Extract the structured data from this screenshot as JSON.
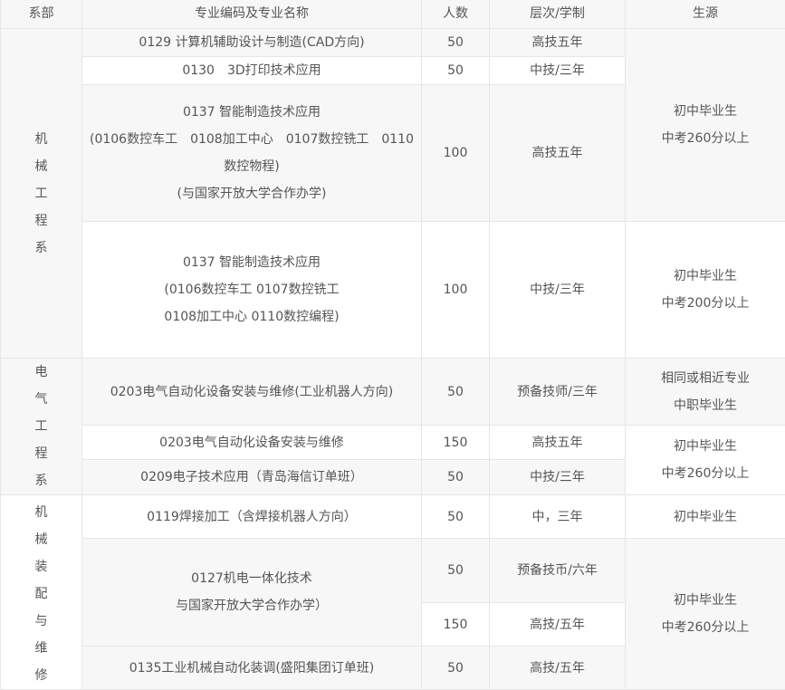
{
  "header": {
    "dept": "系部",
    "major": "专业编码及专业名称",
    "count": "人数",
    "level": "层次/学制",
    "source": "生源"
  },
  "departments": {
    "mech": [
      "机",
      "械",
      "工",
      "程",
      "系"
    ],
    "elec": [
      "电",
      "气",
      "工",
      "程",
      "系"
    ],
    "assembly": [
      "机",
      "械",
      "装",
      "配",
      "与",
      "维",
      "修"
    ]
  },
  "rows": [
    {
      "major": "0129 计算机辅助设计与制造(CAD方向)",
      "count": "50",
      "level": "高技五年"
    },
    {
      "major": "0130　3D打印技术应用",
      "count": "50",
      "level": "中技/三年"
    },
    {
      "major_lines": [
        "0137 智能制造技术应用",
        "(0106数控车工　0108加工中心　0107数控铣工　0110",
        "数控物程)",
        "(与国家开放大学合作办学)"
      ],
      "count": "100",
      "level": "高技五年"
    },
    {
      "major_lines": [
        "0137 智能制造技术应用",
        "(0106数控车工 0107数控铣工",
        "0108加工中心  0110数控编程)"
      ],
      "count": "100",
      "level": "中技/三年"
    },
    {
      "major": "0203电气自动化设备安装与维修(工业机器人方向)",
      "count": "50",
      "level": "预备技师/三年"
    },
    {
      "major": "0203电气自动化设备安装与维修",
      "count": "150",
      "level": "高技五年"
    },
    {
      "major": "0209电子技术应用（青岛海信订单班）",
      "count": "50",
      "level": "中技/三年"
    },
    {
      "major": "0119焊接加工（含焊接机器人方向）",
      "count": "50",
      "level": "中，三年"
    },
    {
      "major_lines": [
        "0127机电一体化技术",
        "与国家开放大学合作办学）"
      ],
      "count": "50",
      "level": "预备技币/六年"
    },
    {
      "count": "150",
      "level": "高技/五年"
    },
    {
      "major": "0135工业机械自动化装调(盛阳集团订单班)",
      "count": "50",
      "level": "高技/五年"
    }
  ],
  "sources": {
    "s1": [
      "初中毕业生",
      "中考260分以上"
    ],
    "s2": [
      "初中毕业生",
      "中考200分以上"
    ],
    "s3": [
      "相同或相近专业",
      "中职毕业生"
    ],
    "s4": [
      "初中毕业生",
      "中考260分以上"
    ],
    "s5": [
      "初中毕业生"
    ],
    "s6": [
      "初中毕业生",
      "中考260分以上"
    ]
  }
}
